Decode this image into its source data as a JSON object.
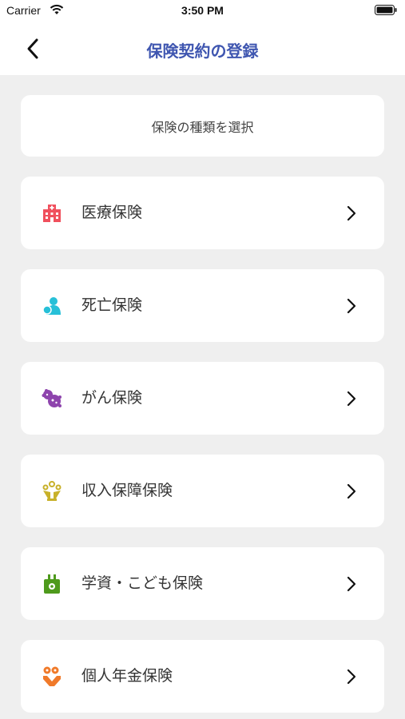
{
  "status": {
    "carrier": "Carrier",
    "time": "3:50 PM"
  },
  "nav": {
    "title": "保険契約の登録"
  },
  "header": {
    "label": "保険の種類を選択"
  },
  "items": [
    {
      "label": "医療保険",
      "icon": "hospital-icon",
      "color": "#f0505d"
    },
    {
      "label": "死亡保険",
      "icon": "person-icon",
      "color": "#27c0d8"
    },
    {
      "label": "がん保険",
      "icon": "cancer-cell-icon",
      "color": "#8e44ad"
    },
    {
      "label": "収入保障保険",
      "icon": "income-icon",
      "color": "#c8b12a"
    },
    {
      "label": "学資・こども保険",
      "icon": "school-bag-icon",
      "color": "#4e9a1c"
    },
    {
      "label": "個人年金保険",
      "icon": "pension-icon",
      "color": "#f07a2a"
    }
  ]
}
